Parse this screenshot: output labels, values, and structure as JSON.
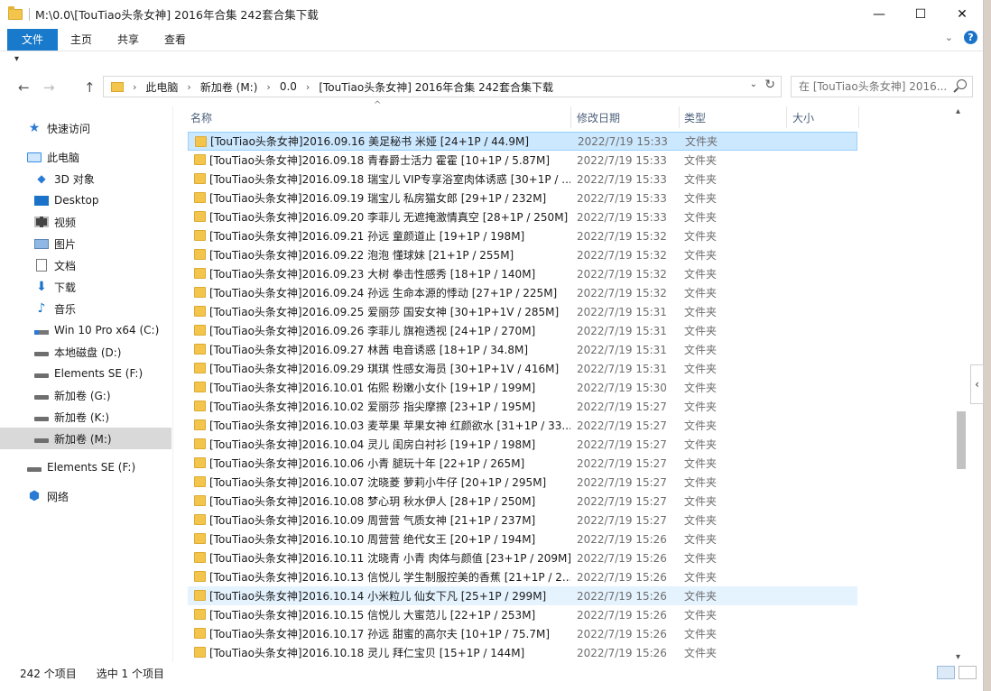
{
  "window": {
    "title": "M:\\0.0\\[TouTiao头条女神] 2016年合集 242套合集下载",
    "min": "—",
    "max": "☐",
    "close": "✕"
  },
  "ribbon": {
    "tabs": [
      "文件",
      "主页",
      "共享",
      "查看"
    ],
    "expand": "⌄",
    "help": "?"
  },
  "qat": "▾",
  "nav": {
    "back": "←",
    "forward": "→",
    "up": "↑",
    "breadcrumb": [
      "此电脑",
      "新加卷 (M:)",
      "0.0",
      "[TouTiao头条女神] 2016年合集 242套合集下载"
    ],
    "crumb_sep": "›",
    "dropdown": "⌄",
    "refresh": "↻",
    "search_placeholder": "在 [TouTiao头条女神] 2016..."
  },
  "sidebar": {
    "items": [
      {
        "label": "快速访问",
        "icon": "star"
      },
      {
        "label": "此电脑",
        "icon": "pc"
      },
      {
        "label": "3D 对象",
        "icon": "cube"
      },
      {
        "label": "Desktop",
        "icon": "desk"
      },
      {
        "label": "视频",
        "icon": "video"
      },
      {
        "label": "图片",
        "icon": "pic"
      },
      {
        "label": "文档",
        "icon": "doc"
      },
      {
        "label": "下载",
        "icon": "down"
      },
      {
        "label": "音乐",
        "icon": "music"
      },
      {
        "label": "Win 10 Pro x64 (C:)",
        "icon": "winc"
      },
      {
        "label": "本地磁盘 (D:)",
        "icon": "drive"
      },
      {
        "label": "Elements SE (F:)",
        "icon": "drive"
      },
      {
        "label": "新加卷 (G:)",
        "icon": "drive"
      },
      {
        "label": "新加卷 (K:)",
        "icon": "drive"
      },
      {
        "label": "新加卷 (M:)",
        "icon": "drive",
        "selected": true
      },
      {
        "label": "Elements SE (F:)",
        "icon": "drive"
      },
      {
        "label": "网络",
        "icon": "net"
      }
    ]
  },
  "columns": {
    "name": "名称",
    "date": "修改日期",
    "type": "类型",
    "size": "大小",
    "sort_indicator": "^"
  },
  "files": [
    {
      "name": "[TouTiao头条女神]2016.09.16 美足秘书 米娅 [24+1P / 44.9M]",
      "date": "2022/7/19 15:33",
      "type": "文件夹",
      "state": "sel"
    },
    {
      "name": "[TouTiao头条女神]2016.09.18 青春爵士活力 霍霍 [10+1P / 5.87M]",
      "date": "2022/7/19 15:33",
      "type": "文件夹"
    },
    {
      "name": "[TouTiao头条女神]2016.09.18 瑞宝儿 VIP专享浴室肉体诱惑 [30+1P / ...",
      "date": "2022/7/19 15:33",
      "type": "文件夹"
    },
    {
      "name": "[TouTiao头条女神]2016.09.19 瑞宝儿 私房猫女郎 [29+1P / 232M]",
      "date": "2022/7/19 15:33",
      "type": "文件夹"
    },
    {
      "name": "[TouTiao头条女神]2016.09.20 李菲儿 无遮掩激情真空 [28+1P / 250M]",
      "date": "2022/7/19 15:33",
      "type": "文件夹"
    },
    {
      "name": "[TouTiao头条女神]2016.09.21 孙远 童颜道止 [19+1P / 198M]",
      "date": "2022/7/19 15:32",
      "type": "文件夹"
    },
    {
      "name": "[TouTiao头条女神]2016.09.22 泡泡 懂球妹 [21+1P / 255M]",
      "date": "2022/7/19 15:32",
      "type": "文件夹"
    },
    {
      "name": "[TouTiao头条女神]2016.09.23 大树 拳击性感秀 [18+1P / 140M]",
      "date": "2022/7/19 15:32",
      "type": "文件夹"
    },
    {
      "name": "[TouTiao头条女神]2016.09.24 孙远 生命本源的悸动 [27+1P / 225M]",
      "date": "2022/7/19 15:32",
      "type": "文件夹"
    },
    {
      "name": "[TouTiao头条女神]2016.09.25 爱丽莎 国安女神 [30+1P+1V / 285M]",
      "date": "2022/7/19 15:31",
      "type": "文件夹"
    },
    {
      "name": "[TouTiao头条女神]2016.09.26 李菲儿 旗袍透视 [24+1P / 270M]",
      "date": "2022/7/19 15:31",
      "type": "文件夹"
    },
    {
      "name": "[TouTiao头条女神]2016.09.27 林茜 电音诱惑 [18+1P / 34.8M]",
      "date": "2022/7/19 15:31",
      "type": "文件夹"
    },
    {
      "name": "[TouTiao头条女神]2016.09.29 琪琪 性感女海员 [30+1P+1V / 416M]",
      "date": "2022/7/19 15:31",
      "type": "文件夹"
    },
    {
      "name": "[TouTiao头条女神]2016.10.01 佑熙 粉嫩小女仆 [19+1P / 199M]",
      "date": "2022/7/19 15:30",
      "type": "文件夹"
    },
    {
      "name": "[TouTiao头条女神]2016.10.02 爱丽莎 指尖摩擦 [23+1P / 195M]",
      "date": "2022/7/19 15:27",
      "type": "文件夹"
    },
    {
      "name": "[TouTiao头条女神]2016.10.03 麦苹果 苹果女神 红颜欲水 [31+1P / 33...",
      "date": "2022/7/19 15:27",
      "type": "文件夹"
    },
    {
      "name": "[TouTiao头条女神]2016.10.04 灵儿 闺房白衬衫 [19+1P / 198M]",
      "date": "2022/7/19 15:27",
      "type": "文件夹"
    },
    {
      "name": "[TouTiao头条女神]2016.10.06 小青 腿玩十年 [22+1P / 265M]",
      "date": "2022/7/19 15:27",
      "type": "文件夹"
    },
    {
      "name": "[TouTiao头条女神]2016.10.07 沈晓菱 萝莉小牛仔 [20+1P / 295M]",
      "date": "2022/7/19 15:27",
      "type": "文件夹"
    },
    {
      "name": "[TouTiao头条女神]2016.10.08 梦心玥 秋水伊人 [28+1P / 250M]",
      "date": "2022/7/19 15:27",
      "type": "文件夹"
    },
    {
      "name": "[TouTiao头条女神]2016.10.09 周营营 气质女神 [21+1P / 237M]",
      "date": "2022/7/19 15:27",
      "type": "文件夹"
    },
    {
      "name": "[TouTiao头条女神]2016.10.10 周营营 绝代女王 [20+1P / 194M]",
      "date": "2022/7/19 15:26",
      "type": "文件夹"
    },
    {
      "name": "[TouTiao头条女神]2016.10.11 沈晓青 小青 肉体与颜值 [23+1P / 209M]",
      "date": "2022/7/19 15:26",
      "type": "文件夹"
    },
    {
      "name": "[TouTiao头条女神]2016.10.13 信悦儿 学生制服控美的香蕉 [21+1P / 2...",
      "date": "2022/7/19 15:26",
      "type": "文件夹"
    },
    {
      "name": "[TouTiao头条女神]2016.10.14 小米粒儿 仙女下凡 [25+1P / 299M]",
      "date": "2022/7/19 15:26",
      "type": "文件夹",
      "state": "hover"
    },
    {
      "name": "[TouTiao头条女神]2016.10.15 信悦儿 大蜜范儿 [22+1P / 253M]",
      "date": "2022/7/19 15:26",
      "type": "文件夹"
    },
    {
      "name": "[TouTiao头条女神]2016.10.17 孙远 甜蜜的高尔夫 [10+1P / 75.7M]",
      "date": "2022/7/19 15:26",
      "type": "文件夹"
    },
    {
      "name": "[TouTiao头条女神]2016.10.18 灵儿 拜仁宝贝 [15+1P / 144M]",
      "date": "2022/7/19 15:26",
      "type": "文件夹"
    }
  ],
  "scrollbar": {
    "up": "▴",
    "down": "▾",
    "position": 0.62,
    "visible_fraction": 0.11
  },
  "side_collapse": "‹",
  "status": {
    "count": "242 个项目",
    "selected": "选中 1 个项目"
  }
}
